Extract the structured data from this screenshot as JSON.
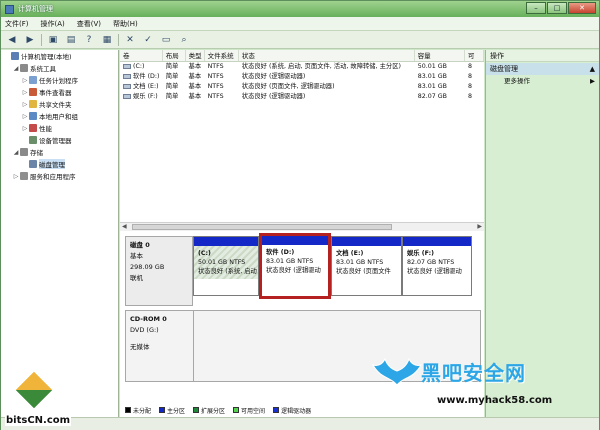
{
  "window": {
    "title": "计算机管理"
  },
  "menu": [
    "文件(F)",
    "操作(A)",
    "查看(V)",
    "帮助(H)"
  ],
  "toolbar": {
    "icons": [
      "back-icon",
      "forward-icon",
      "up-icon",
      "properties-icon",
      "help-icon",
      "delete-icon",
      "settings-icon",
      "open-icon",
      "search-icon",
      "view-icon"
    ]
  },
  "tree": [
    {
      "label": "计算机管理(本地)",
      "depth": 0,
      "expander": "",
      "color": "#5b7fb5"
    },
    {
      "label": "系统工具",
      "depth": 1,
      "expander": "◢",
      "color": "#8a8a8a"
    },
    {
      "label": "任务计划程序",
      "depth": 2,
      "expander": "▷",
      "color": "#7aa1cf"
    },
    {
      "label": "事件查看器",
      "depth": 2,
      "expander": "▷",
      "color": "#c85a3a"
    },
    {
      "label": "共享文件夹",
      "depth": 2,
      "expander": "▷",
      "color": "#e0b640"
    },
    {
      "label": "本地用户和组",
      "depth": 2,
      "expander": "▷",
      "color": "#5b8ac4"
    },
    {
      "label": "性能",
      "depth": 2,
      "expander": "▷",
      "color": "#c54a4a"
    },
    {
      "label": "设备管理器",
      "depth": 2,
      "expander": "",
      "color": "#6b8f6b"
    },
    {
      "label": "存储",
      "depth": 1,
      "expander": "◢",
      "color": "#8a8a8a"
    },
    {
      "label": "磁盘管理",
      "depth": 2,
      "expander": "",
      "color": "#6a85a8",
      "selected": true
    },
    {
      "label": "服务和应用程序",
      "depth": 1,
      "expander": "▷",
      "color": "#8f8f8f"
    }
  ],
  "table": {
    "headers": [
      "卷",
      "布局",
      "类型",
      "文件系统",
      "状态",
      "容量",
      "可"
    ],
    "rows": [
      [
        "(C:)",
        "简单",
        "基本",
        "NTFS",
        "状态良好 (系统, 启动, 页面文件, 活动, 故障转储, 主分区)",
        "50.01 GB",
        "8"
      ],
      [
        "软件 (D:)",
        "简单",
        "基本",
        "NTFS",
        "状态良好 (逻辑驱动器)",
        "83.01 GB",
        "8"
      ],
      [
        "文档 (E:)",
        "简单",
        "基本",
        "NTFS",
        "状态良好 (页面文件, 逻辑驱动器)",
        "83.01 GB",
        "8"
      ],
      [
        "娱乐 (F:)",
        "简单",
        "基本",
        "NTFS",
        "状态良好 (逻辑驱动器)",
        "82.07 GB",
        "8"
      ]
    ]
  },
  "disk0": {
    "name": "磁盘 0",
    "type": "基本",
    "size": "298.09 GB",
    "status": "联机",
    "partitions": [
      {
        "name": "(C:)",
        "size": "50.01 GB NTFS",
        "status": "状态良好 (系统, 启动"
      },
      {
        "name": "软件  (D:)",
        "size": "83.01 GB NTFS",
        "status": "状态良好 (逻辑驱动"
      },
      {
        "name": "文档  (E:)",
        "size": "83.01 GB NTFS",
        "status": "状态良好 (页面文件"
      },
      {
        "name": "娱乐  (F:)",
        "size": "82.07 GB NTFS",
        "status": "状态良好 (逻辑驱动"
      }
    ]
  },
  "cdrom": {
    "name": "CD-ROM 0",
    "type": "DVD (G:)",
    "status": "无媒体"
  },
  "legend": [
    {
      "label": "未分配",
      "color": "#000000"
    },
    {
      "label": "主分区",
      "color": "#1428c8"
    },
    {
      "label": "扩展分区",
      "color": "#1f8a3a"
    },
    {
      "label": "可用空间",
      "color": "#52d24f"
    },
    {
      "label": "逻辑驱动器",
      "color": "#1b2fd6"
    }
  ],
  "actions": {
    "title": "操作",
    "section": "磁盘管理",
    "more": "更多操作"
  },
  "watermark": {
    "left": "bitsCN.com",
    "brand": "黑吧安全网",
    "url": "www.myhack58.com"
  }
}
